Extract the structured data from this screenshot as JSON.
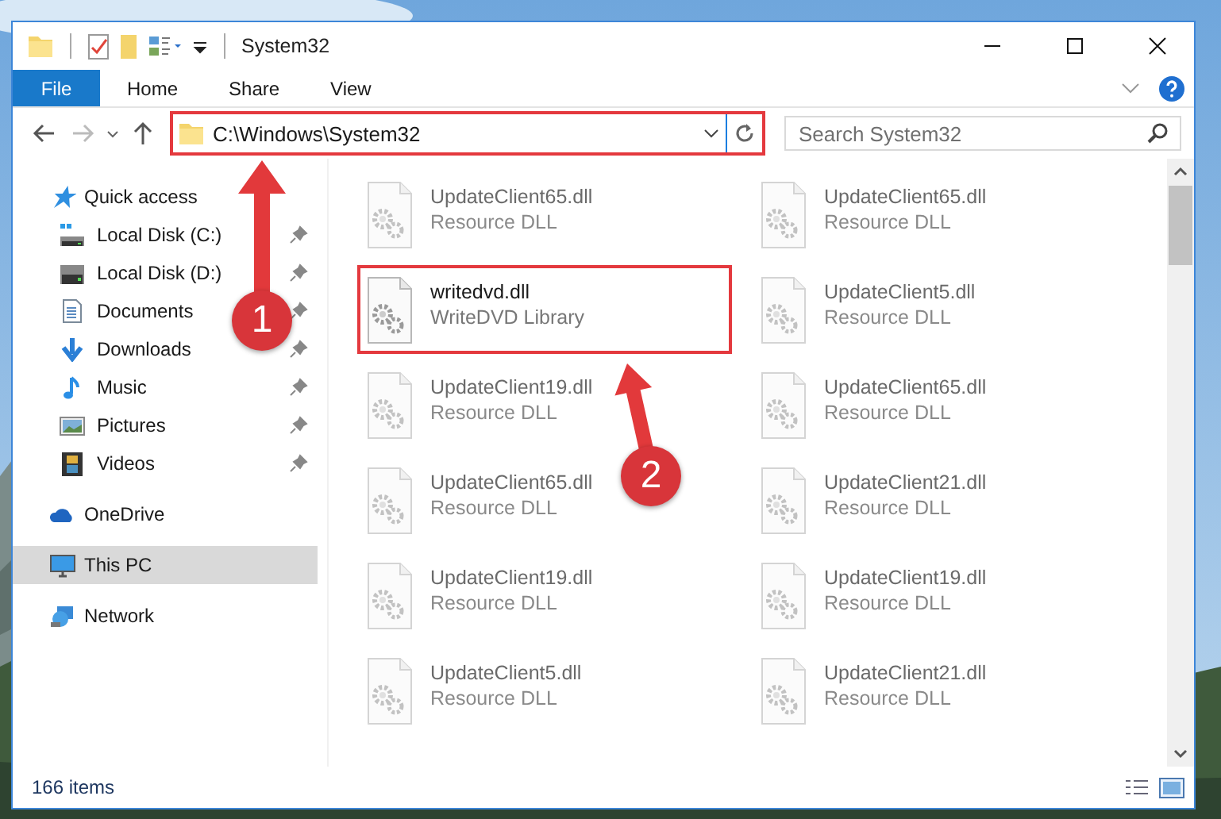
{
  "window": {
    "title": "System32"
  },
  "ribbon": {
    "tabs": [
      {
        "label": "File",
        "selected": true
      },
      {
        "label": "Home",
        "selected": false
      },
      {
        "label": "Share",
        "selected": false
      },
      {
        "label": "View",
        "selected": false
      }
    ]
  },
  "address_bar": {
    "path": "C:\\Windows\\System32",
    "highlighted": true
  },
  "search": {
    "placeholder": "Search System32"
  },
  "navigation": [
    {
      "label": "Quick access",
      "selected": false,
      "children": [
        {
          "label": "Local Disk (C:)",
          "pinned": true,
          "selected": false
        },
        {
          "label": "Local Disk (D:)",
          "pinned": true,
          "selected": false
        },
        {
          "label": "Documents",
          "pinned": true,
          "selected": false
        },
        {
          "label": "Downloads",
          "pinned": true,
          "selected": false
        },
        {
          "label": "Music",
          "pinned": true,
          "selected": false
        },
        {
          "label": "Pictures",
          "pinned": true,
          "selected": false
        },
        {
          "label": "Videos",
          "pinned": true,
          "selected": false
        }
      ]
    },
    {
      "label": "OneDrive",
      "selected": false
    },
    {
      "label": "This PC",
      "selected": true
    },
    {
      "label": "Network",
      "selected": false
    }
  ],
  "files": [
    {
      "name": "UpdateClient65.dll",
      "type": "Resource DLL",
      "blurred": true,
      "highlighted": false
    },
    {
      "name": "UpdateClient65.dll",
      "type": "Resource DLL",
      "blurred": true,
      "highlighted": false
    },
    {
      "name": "writedvd.dll",
      "type": "WriteDVD Library",
      "blurred": false,
      "highlighted": true
    },
    {
      "name": "UpdateClient5.dll",
      "type": "Resource DLL",
      "blurred": true,
      "highlighted": false
    },
    {
      "name": "UpdateClient19.dll",
      "type": "Resource DLL",
      "blurred": true,
      "highlighted": false
    },
    {
      "name": "UpdateClient65.dll",
      "type": "Resource DLL",
      "blurred": true,
      "highlighted": false
    },
    {
      "name": "UpdateClient65.dll",
      "type": "Resource DLL",
      "blurred": true,
      "highlighted": false
    },
    {
      "name": "UpdateClient21.dll",
      "type": "Resource DLL",
      "blurred": true,
      "highlighted": false
    },
    {
      "name": "UpdateClient19.dll",
      "type": "Resource DLL",
      "blurred": true,
      "highlighted": false
    },
    {
      "name": "UpdateClient19.dll",
      "type": "Resource DLL",
      "blurred": true,
      "highlighted": false
    },
    {
      "name": "UpdateClient5.dll",
      "type": "Resource DLL",
      "blurred": true,
      "highlighted": false
    },
    {
      "name": "UpdateClient21.dll",
      "type": "Resource DLL",
      "blurred": true,
      "highlighted": false
    }
  ],
  "status_bar": {
    "item_count": "166 items"
  },
  "annotations": [
    {
      "number": "1"
    },
    {
      "number": "2"
    }
  ]
}
